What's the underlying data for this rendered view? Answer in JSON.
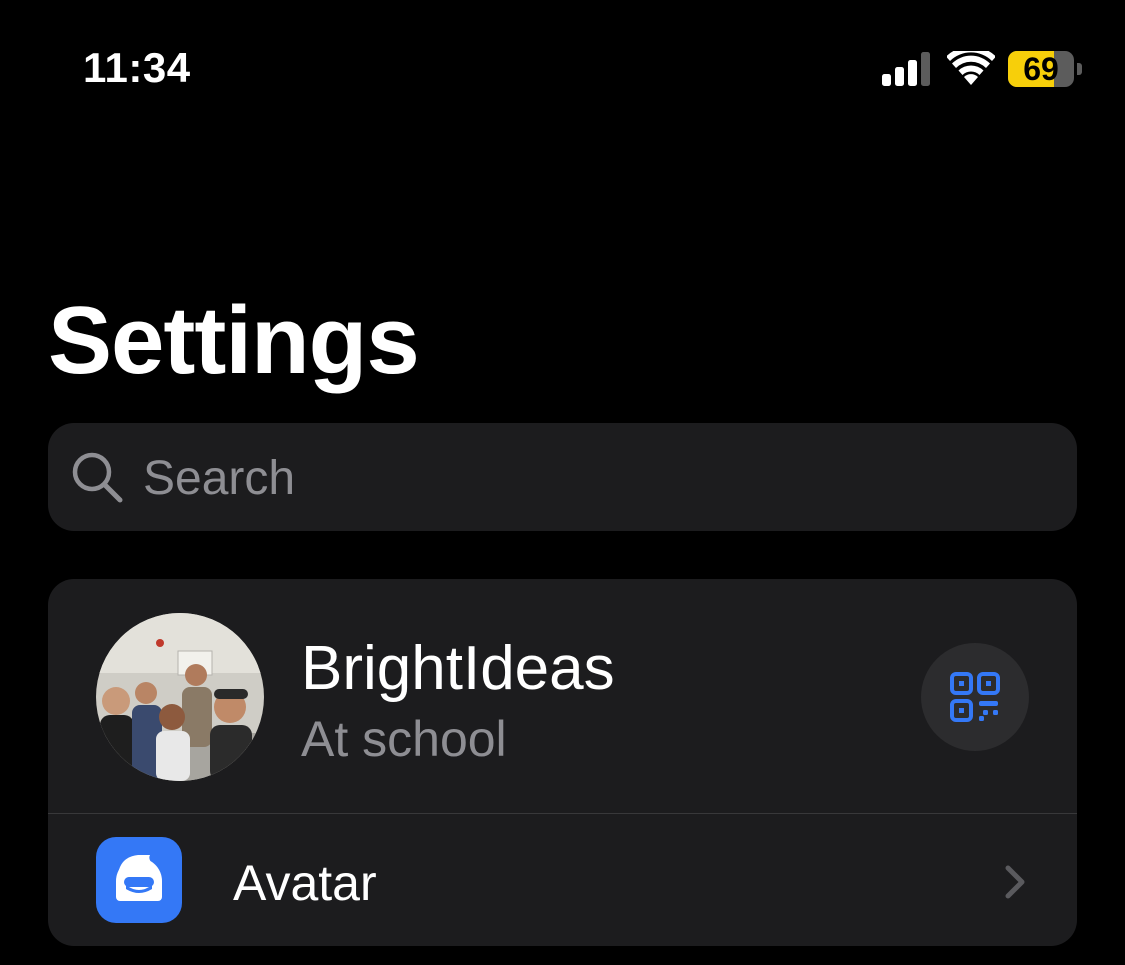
{
  "status_bar": {
    "time": "11:34",
    "battery_level": "69",
    "battery_percent": 69,
    "battery_color": "#f7cf0a",
    "icons": [
      "signal-icon",
      "wifi-icon",
      "battery-icon"
    ]
  },
  "header": {
    "title": "Settings"
  },
  "search": {
    "placeholder": "Search",
    "value": "",
    "icon": "search-icon"
  },
  "profile": {
    "name": "BrightIdeas",
    "status": "At school",
    "qr_icon": "qr-code-icon",
    "accent_color": "#3478f6"
  },
  "menu": {
    "items": [
      {
        "label": "Avatar",
        "icon": "avatar-app-icon",
        "icon_color": "#3478f6",
        "trailing": "chevron-right-icon"
      }
    ]
  }
}
